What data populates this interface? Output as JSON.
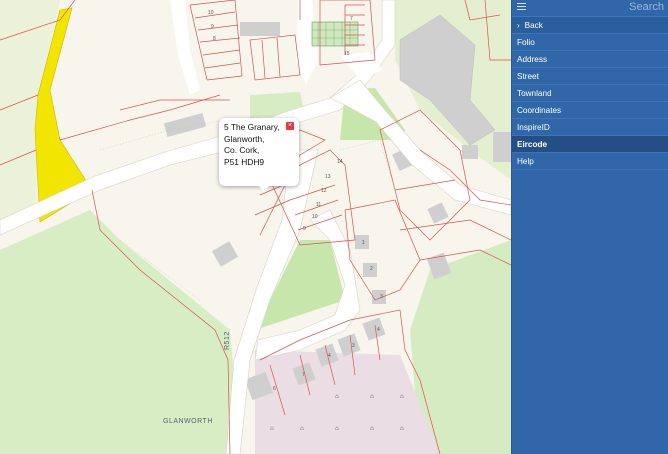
{
  "popup": {
    "lines": [
      "5 The Granary,",
      "Glanworth,",
      "Co. Cork,",
      "P51 HDH9"
    ],
    "close_glyph": "×"
  },
  "map": {
    "place_label": "GLANWORTH",
    "road_label": "R512"
  },
  "sidebar": {
    "search_label": "Search",
    "back_label": "Back",
    "back_chevron": "›",
    "items": [
      {
        "label": "Folio",
        "active": false
      },
      {
        "label": "Address",
        "active": false
      },
      {
        "label": "Street",
        "active": false
      },
      {
        "label": "Townland",
        "active": false
      },
      {
        "label": "Coordinates",
        "active": false
      },
      {
        "label": "InspireID",
        "active": false
      },
      {
        "label": "Eircode",
        "active": true
      },
      {
        "label": "Help",
        "active": false
      }
    ]
  },
  "colors": {
    "sidebar_bg": "#2f67a9",
    "parcel_highlight": "#f2e600",
    "green_area": "#d5ecc2",
    "boundary": "#d9534f",
    "road": "#ffffff"
  },
  "icons": {
    "menu": "menu-icon",
    "close": "close-icon",
    "chevron": "chevron-right-icon"
  }
}
